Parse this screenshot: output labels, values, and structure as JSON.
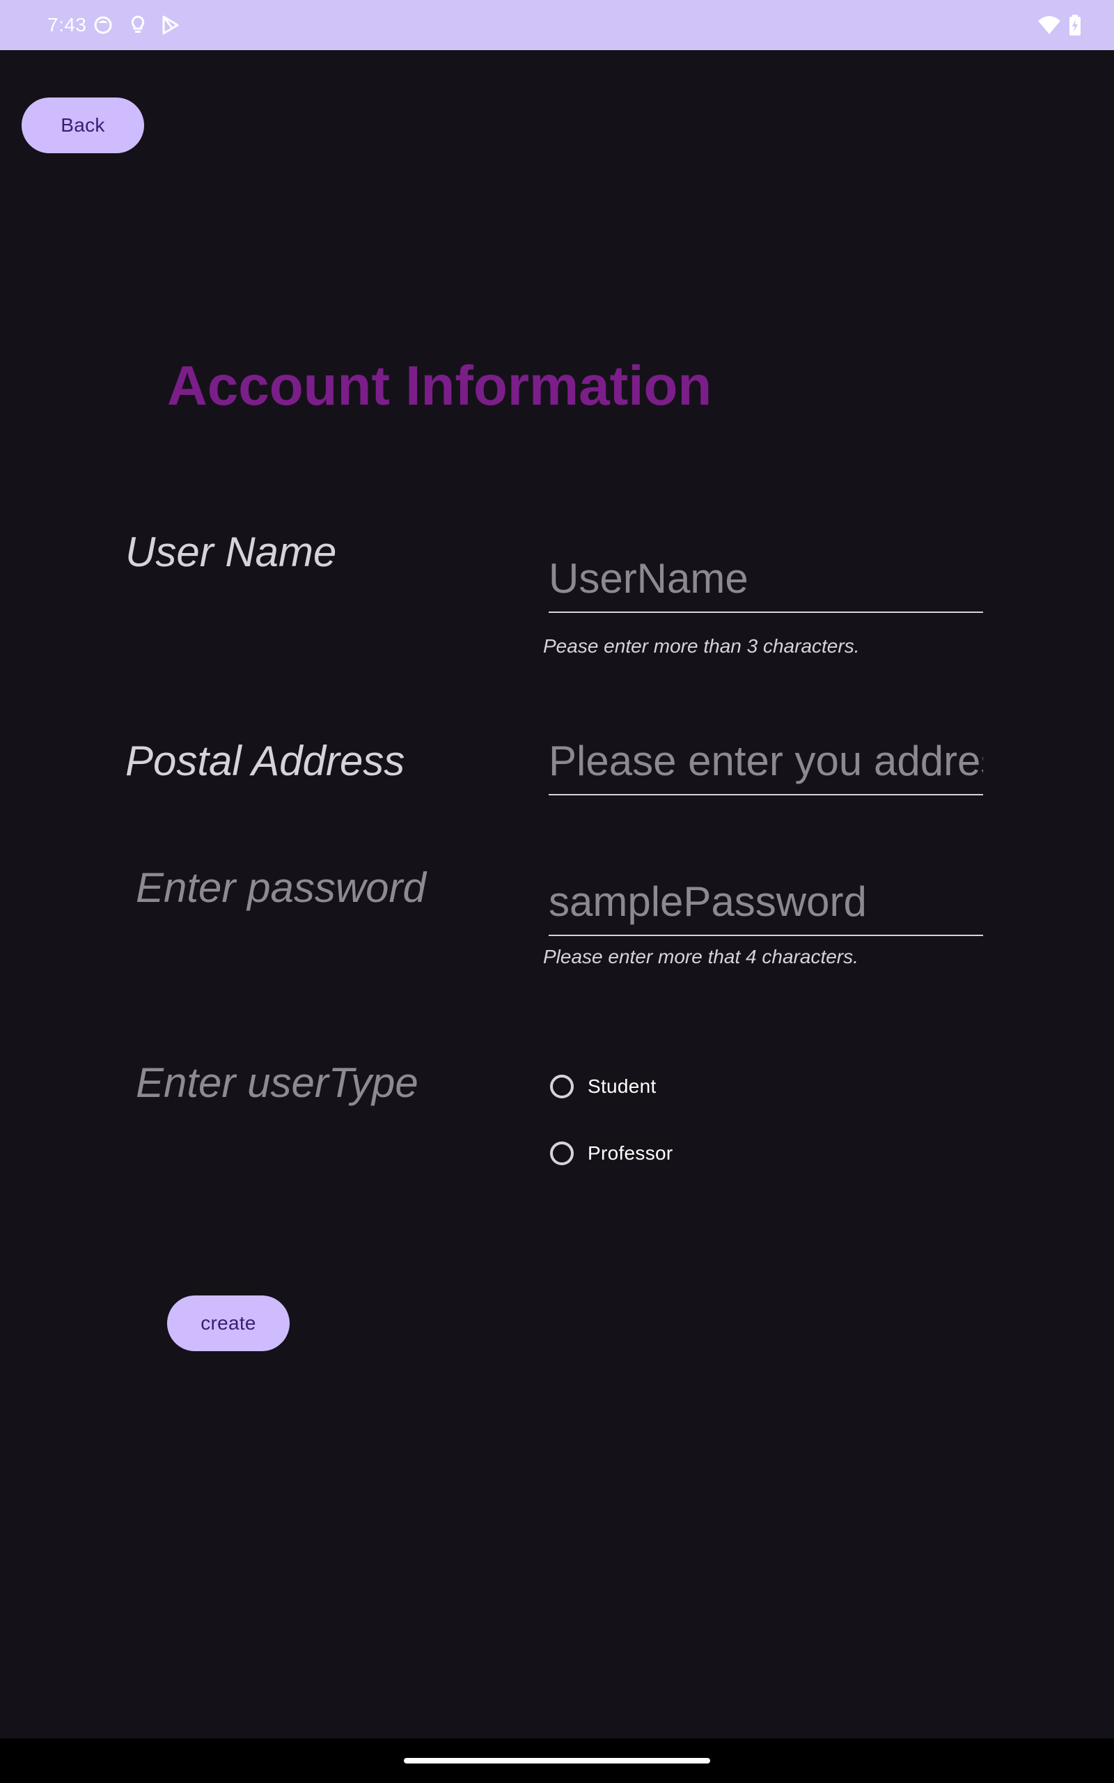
{
  "status_bar": {
    "time": "7:43",
    "left_icons": [
      "face-notification-icon",
      "lightbulb-icon",
      "play-store-icon"
    ],
    "right_icons": [
      "wifi-icon",
      "battery-charging-icon"
    ],
    "background_color": "#cfc3f7"
  },
  "header": {
    "back_label": "Back"
  },
  "title": "Account Information",
  "form": {
    "username": {
      "label": "User Name",
      "placeholder": "UserName",
      "value": "",
      "helper": "Pease enter more than 3 characters."
    },
    "address": {
      "label": "Postal Address",
      "placeholder": "Please enter you address",
      "value": ""
    },
    "password": {
      "label": "Enter password",
      "placeholder": "samplePassword",
      "value": "",
      "helper": "Please enter more that 4 characters."
    },
    "usertype": {
      "label": "Enter userType",
      "options": [
        "Student",
        "Professor"
      ],
      "selected": null
    },
    "create_label": "create"
  },
  "colors": {
    "background": "#141218",
    "accent_button": "#cfbcff",
    "button_text": "#381e72",
    "title": "#7b1e8a"
  }
}
